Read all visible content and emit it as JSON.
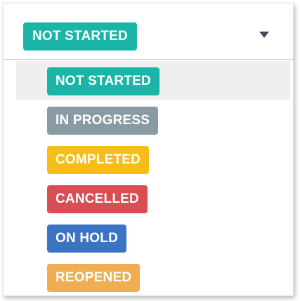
{
  "select": {
    "selected": {
      "label": "NOT STARTED",
      "color": "#1ab5a6"
    },
    "chevron_icon": "chevron-down-icon"
  },
  "options": [
    {
      "label": "NOT STARTED",
      "color": "#1ab5a6",
      "highlighted": true
    },
    {
      "label": "IN PROGRESS",
      "color": "#8a9aa4",
      "highlighted": false
    },
    {
      "label": "COMPLETED",
      "color": "#f6bd17",
      "highlighted": false
    },
    {
      "label": "CANCELLED",
      "color": "#d94e53",
      "highlighted": false
    },
    {
      "label": "ON HOLD",
      "color": "#3a74c2",
      "highlighted": false
    },
    {
      "label": "REOPENED",
      "color": "#f0ad52",
      "highlighted": false
    }
  ]
}
